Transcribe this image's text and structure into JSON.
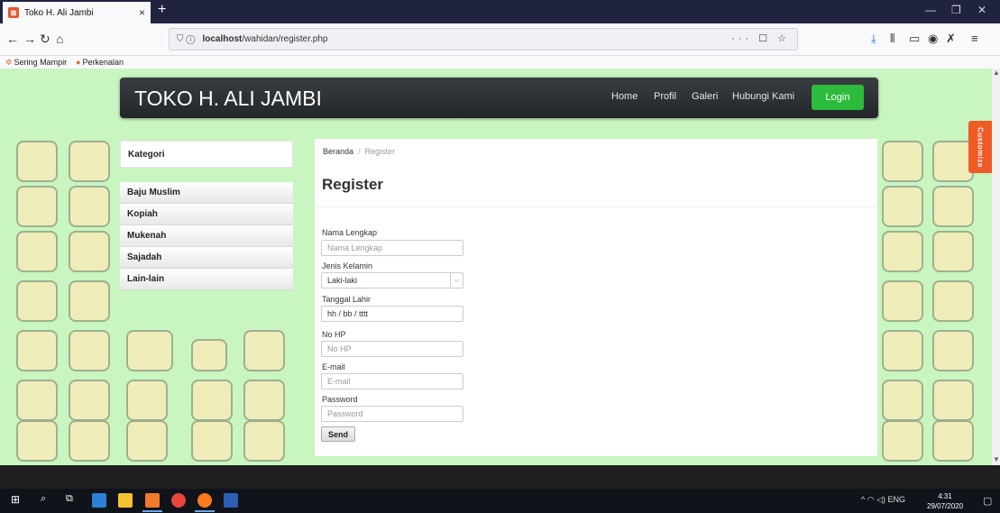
{
  "browser": {
    "tab_title": "Toko H. Ali Jambi",
    "tab_close": "×",
    "new_tab": "+",
    "url_host": "localhost",
    "url_path": "/wahidan/register.php",
    "url_right_icons": "··· ☐ ☆",
    "bookmarks": [
      "Sering Mampir",
      "Perkenalan"
    ]
  },
  "site": {
    "brand": "TOKO H. ALI JAMBI",
    "menu": [
      "Home",
      "Profil",
      "Galeri",
      "Hubungi Kami"
    ],
    "login": "Login",
    "customize": "Customize"
  },
  "sidebar": {
    "heading": "Kategori",
    "items": [
      "Baju Muslim",
      "Kopiah",
      "Mukenah",
      "Sajadah",
      "Lain-lain"
    ]
  },
  "content": {
    "breadcrumb_home": "Beranda",
    "breadcrumb_sep": "/",
    "breadcrumb_current": "Register",
    "title": "Register",
    "fields": {
      "nama_label": "Nama Lengkap",
      "nama_placeholder": "Nama Lengkap",
      "jk_label": "Jenis Kelamin",
      "jk_value": "Laki-laki",
      "tgl_label": "Tanggal Lahir",
      "tgl_value": "hh / bb / tttt",
      "hp_label": "No HP",
      "hp_placeholder": "No HP",
      "email_label": "E-mail",
      "email_placeholder": "E-mail",
      "pw_label": "Password",
      "pw_placeholder": "Password"
    },
    "send": "Send"
  },
  "taskbar": {
    "tray": "ENG",
    "time": "4:31",
    "date": "29/07/2020"
  },
  "colors": {
    "page_bg": "#c8f5c0",
    "login_green": "#2dbb3c",
    "customize_orange": "#ef5a25",
    "navbar_dark": "#2b2f33"
  }
}
